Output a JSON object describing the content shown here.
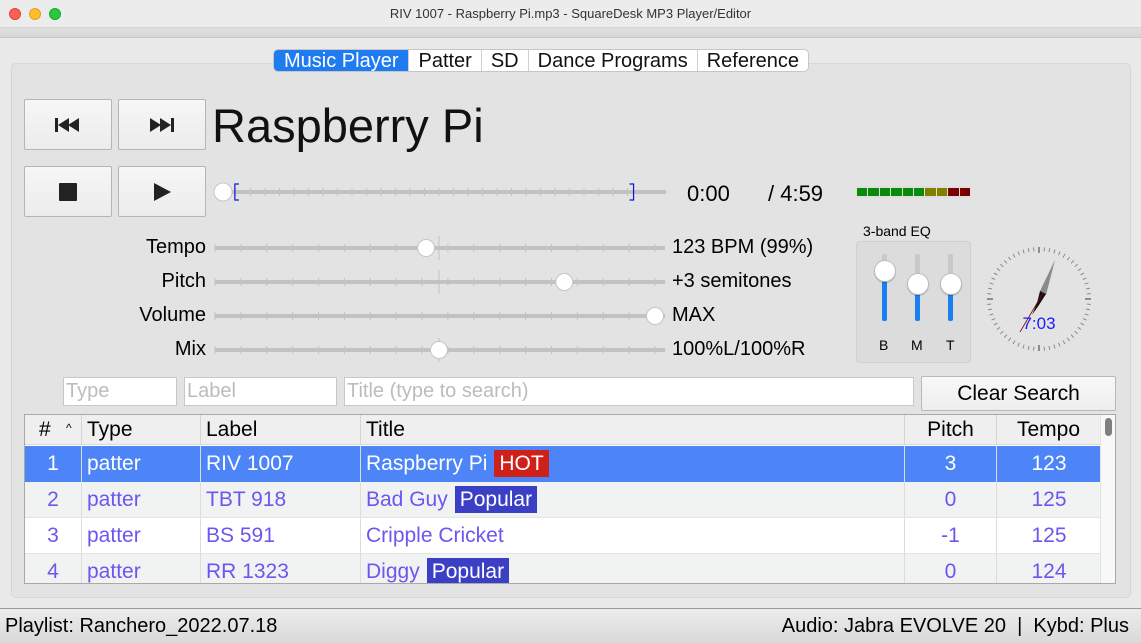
{
  "window": {
    "title": "RIV 1007 - Raspberry Pi.mp3 - SquareDesk MP3 Player/Editor"
  },
  "tabs": [
    {
      "label": "Music Player",
      "active": true
    },
    {
      "label": "Patter",
      "active": false
    },
    {
      "label": "SD",
      "active": false
    },
    {
      "label": "Dance Programs",
      "active": false
    },
    {
      "label": "Reference",
      "active": false
    }
  ],
  "transport": {
    "previous_icon": "skip-back-icon",
    "next_icon": "skip-forward-icon",
    "stop_icon": "stop-icon",
    "play_icon": "play-icon"
  },
  "now_playing": {
    "title": "Raspberry Pi",
    "current_time": "0:00",
    "total_time": "/ 4:59",
    "seek_fraction": 0.0,
    "loop_start_fraction": 0.02,
    "loop_end_fraction": 0.92
  },
  "vu_meter": {
    "segments": [
      "#0a8a0a",
      "#0a8a0a",
      "#0a8a0a",
      "#0a8a0a",
      "#0a8a0a",
      "#0a8a0a",
      "#808000",
      "#808000",
      "#7a0000",
      "#7a0000"
    ]
  },
  "sliders": [
    {
      "label": "Tempo",
      "value": "123 BPM (99%)",
      "fraction": 0.47,
      "center_mark": true
    },
    {
      "label": "Pitch",
      "value": "+3 semitones",
      "fraction": 0.79,
      "center_mark": true
    },
    {
      "label": "Volume",
      "value": "MAX",
      "fraction": 1.0,
      "center_mark": false
    },
    {
      "label": "Mix",
      "value": "100%L/100%R",
      "fraction": 0.5,
      "center_mark": true
    }
  ],
  "eq": {
    "label": "3-band EQ",
    "bands": [
      {
        "label": "B",
        "fraction": 0.75
      },
      {
        "label": "M",
        "fraction": 0.55
      },
      {
        "label": "T",
        "fraction": 0.55
      }
    ]
  },
  "clock": {
    "time_text": "7:03",
    "accent": "#1a1aff"
  },
  "search": {
    "type_placeholder": "Type",
    "label_placeholder": "Label",
    "title_placeholder": "Title (type to search)",
    "clear_label": "Clear Search"
  },
  "table": {
    "columns": [
      "#",
      "Type",
      "Label",
      "Title",
      "Pitch",
      "Tempo"
    ],
    "sort_indicator": "^",
    "rows": [
      {
        "num": "1",
        "type": "patter",
        "label": "RIV 1007",
        "title": "Raspberry Pi",
        "tag": "HOT",
        "tag_color": "#d0201a",
        "pitch": "3",
        "tempo": "123",
        "selected": true
      },
      {
        "num": "2",
        "type": "patter",
        "label": "TBT 918",
        "title": "Bad Guy",
        "tag": "Popular",
        "tag_color": "#3b3fc4",
        "pitch": "0",
        "tempo": "125",
        "selected": false
      },
      {
        "num": "3",
        "type": "patter",
        "label": "BS 591",
        "title": "Cripple Cricket",
        "tag": "",
        "tag_color": "",
        "pitch": "-1",
        "tempo": "125",
        "selected": false
      },
      {
        "num": "4",
        "type": "patter",
        "label": "RR 1323",
        "title": "Diggy",
        "tag": "Popular",
        "tag_color": "#3b3fc4",
        "pitch": "0",
        "tempo": "124",
        "selected": false
      }
    ]
  },
  "status": {
    "left": "Playlist: Ranchero_2022.07.18",
    "right": "Audio: Jabra EVOLVE 20  |  Kybd: Plus"
  }
}
